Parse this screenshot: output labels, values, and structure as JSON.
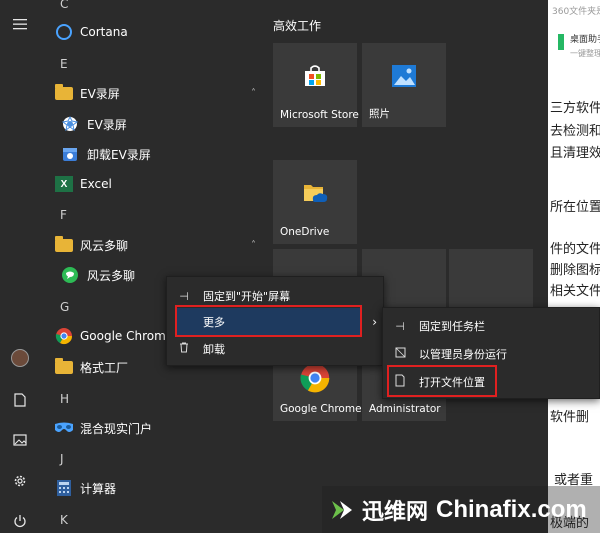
{
  "background_doc": {
    "top_text": "360文件夹是",
    "card_title": "桌面助手",
    "card_sub": "一键整理",
    "lines": [
      "三方软件",
      "去检测和",
      "且清理效果",
      "所在位置,",
      "件的文件",
      "删除图标,",
      "相关文件",
      "软件删",
      "或者重",
      "极端的"
    ]
  },
  "rail": {
    "icons": [
      "hamburger-icon",
      "user-avatar",
      "document-icon",
      "pictures-icon",
      "settings-icon",
      "power-icon"
    ]
  },
  "app_list": [
    {
      "type": "letter",
      "text": "C"
    },
    {
      "type": "app",
      "label": "Cortana",
      "icon": "cortana-icon"
    },
    {
      "type": "letter",
      "text": "E"
    },
    {
      "type": "folder",
      "label": "EV录屏",
      "expanded": true
    },
    {
      "type": "sub",
      "label": "EV录屏",
      "icon": "ev-icon"
    },
    {
      "type": "sub",
      "label": "卸载EV录屏",
      "icon": "uninstall-ev-icon"
    },
    {
      "type": "app",
      "label": "Excel",
      "icon": "excel-icon"
    },
    {
      "type": "letter",
      "text": "F"
    },
    {
      "type": "folder",
      "label": "风云多聊",
      "expanded": true
    },
    {
      "type": "sub",
      "label": "风云多聊",
      "icon": "chat-icon"
    },
    {
      "type": "letter",
      "text": "G"
    },
    {
      "type": "app",
      "label": "Google Chrome",
      "icon": "chrome-icon"
    },
    {
      "type": "folder",
      "label": "格式工厂",
      "expanded": false
    },
    {
      "type": "letter",
      "text": "H"
    },
    {
      "type": "app",
      "label": "混合现实门户",
      "icon": "mixed-reality-icon"
    },
    {
      "type": "letter",
      "text": "J"
    },
    {
      "type": "app",
      "label": "计算器",
      "icon": "calculator-icon"
    },
    {
      "type": "letter",
      "text": "K"
    }
  ],
  "tiles": {
    "group_title": "高效工作",
    "items": [
      {
        "label": "Microsoft Store",
        "icon": "store-icon"
      },
      {
        "label": "照片",
        "icon": "photos-icon"
      },
      {
        "label": "OneDrive",
        "icon": "onedrive-icon"
      },
      {
        "label": "Google Chrome",
        "icon": "chrome-icon"
      },
      {
        "label": "Administrator",
        "icon": "folder-icon"
      }
    ]
  },
  "context_menu": {
    "items": [
      {
        "label": "固定到\"开始\"屏幕",
        "icon": "pin-icon"
      },
      {
        "label": "更多",
        "icon": "",
        "highlighted": true,
        "has_submenu": true
      },
      {
        "label": "卸载",
        "icon": "trash-icon"
      }
    ]
  },
  "submenu": {
    "items": [
      {
        "label": "固定到任务栏",
        "icon": "pin-icon"
      },
      {
        "label": "以管理员身份运行",
        "icon": "shield-icon"
      },
      {
        "label": "打开文件位置",
        "icon": "open-file-location-icon"
      }
    ]
  },
  "watermark": {
    "cn": "迅维网",
    "en": "Chinafix.com"
  },
  "colors": {
    "start_bg": "#2b2b2b",
    "tile_bg": "#3a3a3a",
    "highlight": "#1e3a5f",
    "red_box": "#e02020",
    "folder": "#e8b437"
  }
}
